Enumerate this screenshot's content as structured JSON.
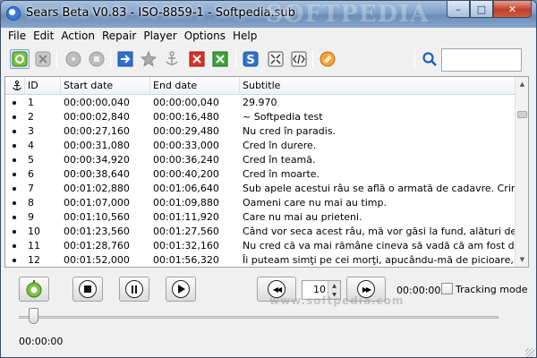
{
  "window": {
    "title": "Sears Beta V0.83 - ISO-8859-1 - Softpedia.sub",
    "watermark": "SOFTPEDIA",
    "minimize": "–",
    "maximize": "□",
    "close": "✕"
  },
  "menu": [
    "File",
    "Edit",
    "Action",
    "Repair",
    "Player",
    "Options",
    "Help"
  ],
  "toolbar": {
    "icons": [
      "new-file-icon",
      "close-file-icon",
      "disc-icon",
      "disc-alt-icon",
      "star-icon",
      "export-icon",
      "anchor-icon",
      "delete-icon",
      "check-icon",
      "s-logo-icon",
      "expand-icon",
      "code-icon",
      "bomb-icon",
      "search-icon"
    ],
    "search_value": ""
  },
  "grid": {
    "columns": [
      "",
      "ID",
      "Start date",
      "End date",
      "Subtitle"
    ],
    "rows": [
      {
        "id": "1",
        "start": "00:00:00,040",
        "end": "00:00:00,040",
        "subtitle": "29.970"
      },
      {
        "id": "2",
        "start": "00:00:02,840",
        "end": "00:00:16,480",
        "subtitle": "~ Softpedia test"
      },
      {
        "id": "3",
        "start": "00:00:27,160",
        "end": "00:00:29,480",
        "subtitle": "Nu cred în paradis."
      },
      {
        "id": "4",
        "start": "00:00:31,080",
        "end": "00:00:33,000",
        "subtitle": "Cred în durere."
      },
      {
        "id": "5",
        "start": "00:00:34,920",
        "end": "00:00:36,240",
        "subtitle": "Cred în teamă."
      },
      {
        "id": "6",
        "start": "00:00:38,640",
        "end": "00:00:40,200",
        "subtitle": "Cred în moarte."
      },
      {
        "id": "7",
        "start": "00:01:02,880",
        "end": "00:01:06,640",
        "subtitle": "Sub apele acestui râu se află o armată de cadavre. Criminali."
      },
      {
        "id": "8",
        "start": "00:01:07,000",
        "end": "00:01:09,880",
        "subtitle": "Oameni care nu mai au timp."
      },
      {
        "id": "9",
        "start": "00:01:10,560",
        "end": "00:01:11,920",
        "subtitle": "Care nu mai au prieteni."
      },
      {
        "id": "10",
        "start": "00:01:23,560",
        "end": "00:01:27,560",
        "subtitle": "Când vor seca acest râu, mă vor găsi la fund, alături de ei."
      },
      {
        "id": "11",
        "start": "00:01:28,760",
        "end": "00:01:32,160",
        "subtitle": "Nu cred că va mai rămâne cineva să vadă că am fost diferit."
      },
      {
        "id": "12",
        "start": "00:01:52,000",
        "end": "00:01:56,320",
        "subtitle": "Îi puteam simţi pe cei morţi, apucându-mă de picioare,"
      }
    ]
  },
  "player": {
    "step_value": "10",
    "time": "00:00:00",
    "tracking_label": "Tracking mode",
    "tracking_checked": false,
    "position": "00:00:00",
    "slider_fraction": 0.03,
    "watermark": "www.softpedia.com"
  }
}
